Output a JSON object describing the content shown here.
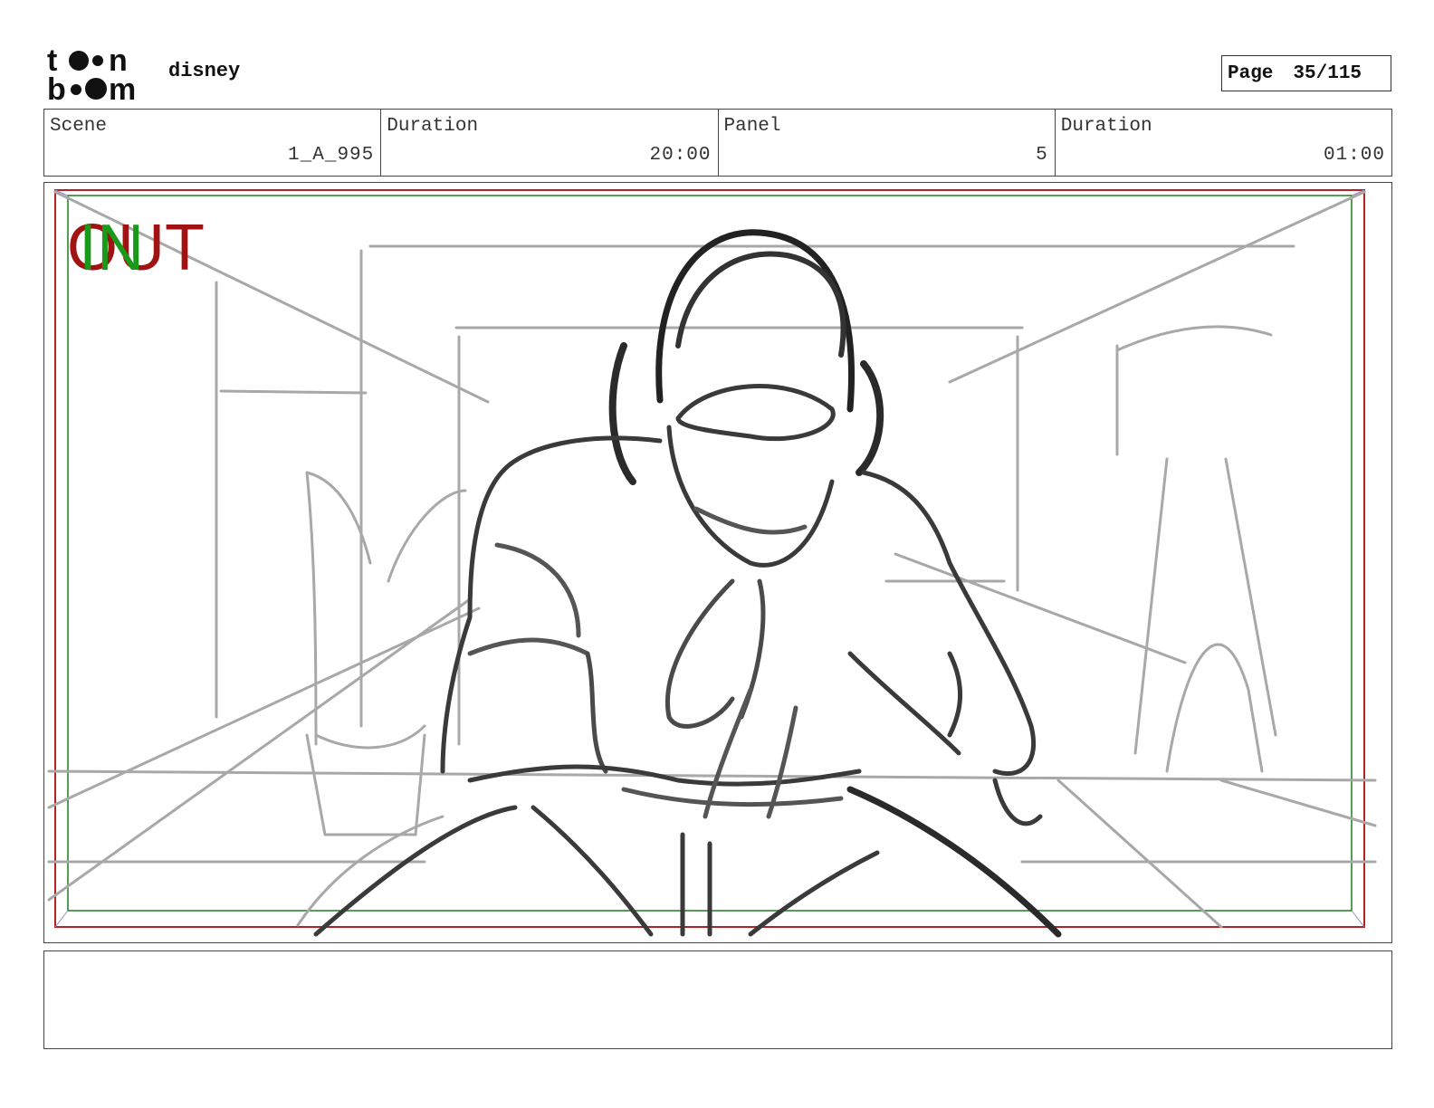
{
  "header": {
    "logo_text": "toon boom",
    "project": "disney",
    "page_label": "Page",
    "page_value": "35/115"
  },
  "info": {
    "scene_label": "Scene",
    "scene_value": "1_A_995",
    "scene_duration_label": "Duration",
    "scene_duration_value": "20:00",
    "panel_label": "Panel",
    "panel_value": "5",
    "panel_duration_label": "Duration",
    "panel_duration_value": "01:00"
  },
  "panel": {
    "marker_out": "OUT",
    "marker_in": "IN",
    "out_color": "#a11212",
    "in_color": "#1a9a1a"
  },
  "notes": {
    "text": ""
  }
}
